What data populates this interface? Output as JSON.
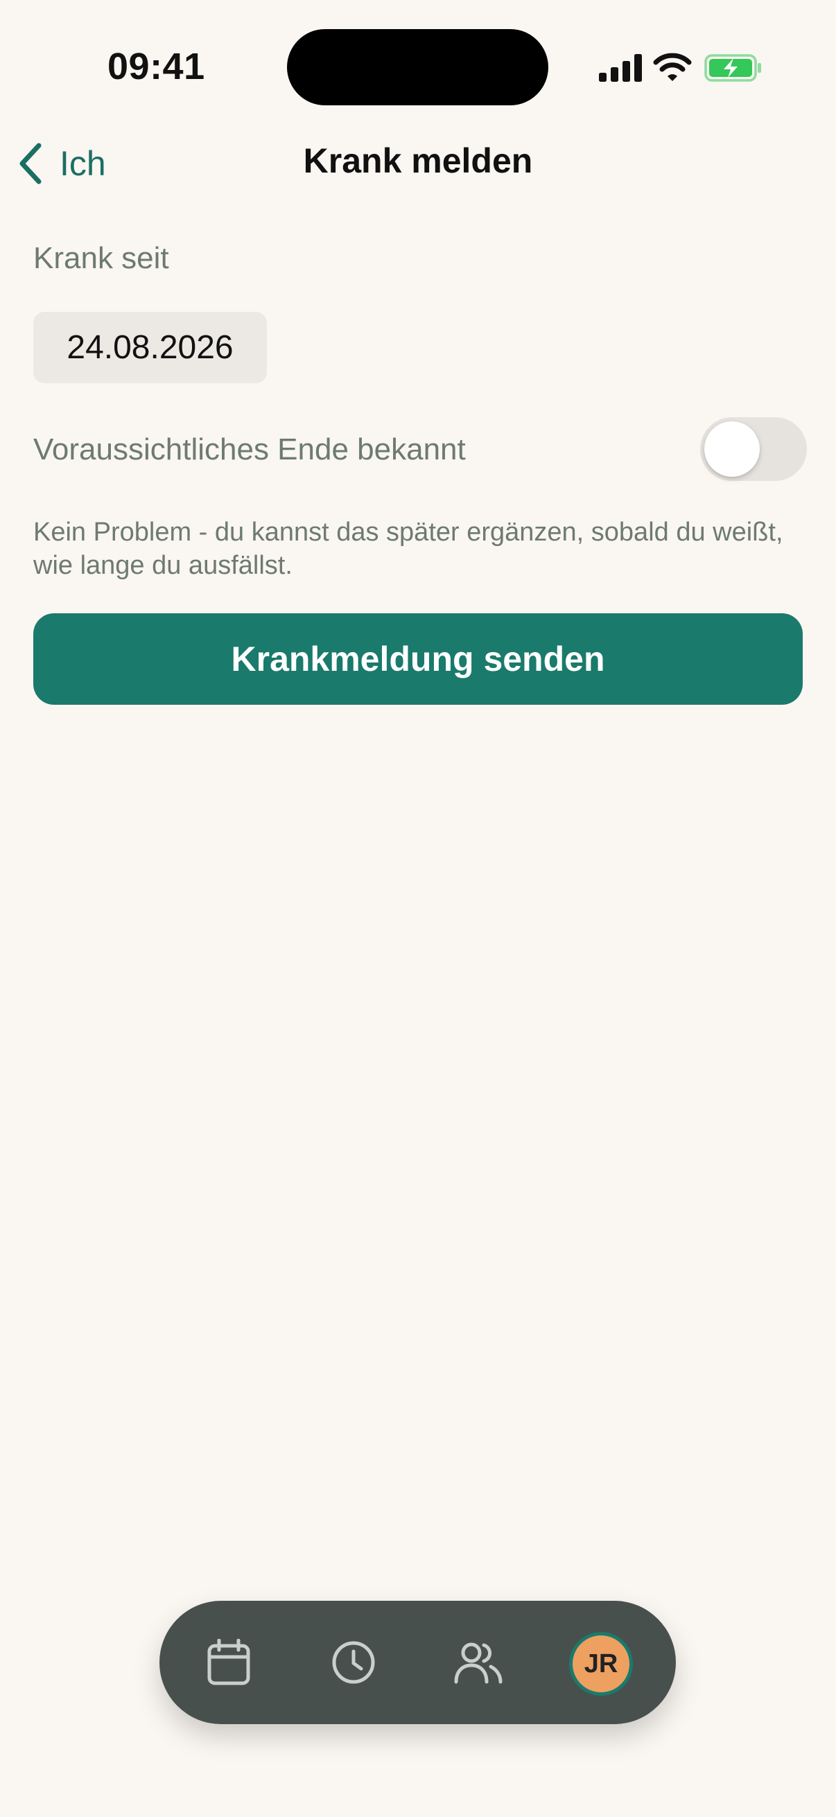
{
  "status_bar": {
    "time": "09:41",
    "icons": [
      "signal-icon",
      "wifi-icon",
      "battery-charging-icon"
    ]
  },
  "nav": {
    "back_label": "Ich",
    "title": "Krank melden"
  },
  "form": {
    "sick_since_label": "Krank seit",
    "sick_since_value": "24.08.2026",
    "end_known_label": "Voraussichtliches Ende bekannt",
    "end_known_on": false,
    "hint": "Kein Problem - du kannst das später ergänzen, sobald du weißt, wie lange du ausfällst.",
    "submit_label": "Krankmeldung senden"
  },
  "tab_bar": {
    "items": [
      "calendar-icon",
      "clock-icon",
      "team-icon"
    ],
    "avatar_initials": "JR"
  },
  "colors": {
    "accent": "#1A7A6C",
    "background": "#FAF6F1",
    "muted_text": "#6D7A73",
    "tab_bar": "#48504D",
    "avatar": "#EEA060",
    "battery": "#34C759"
  }
}
